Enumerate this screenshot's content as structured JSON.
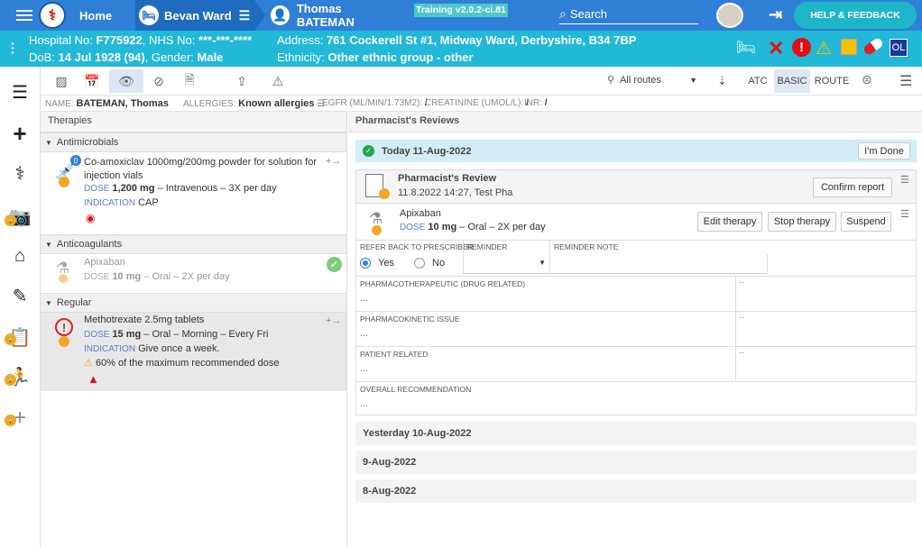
{
  "topbar": {
    "home_label": "Home",
    "ward_label": "Bevan Ward",
    "patient_label": "Thomas BATEMAN",
    "training_badge": "Training v2.0.2-ci.81",
    "search_placeholder": "Search",
    "help_label": "HELP & FEEDBACK"
  },
  "patient": {
    "hospital_no_label": "Hospital No:",
    "hospital_no": "F775922",
    "nhs_label": "NHS No:",
    "nhs_no": "***-***-****",
    "dob_label": "DoB:",
    "dob": "14 Jul 1928 (94)",
    "gender_label": "Gender:",
    "gender": "Male",
    "address_label": "Address:",
    "address": "761 Cockerell St #1, Midway Ward, Derbyshire, B34 7BP",
    "ethnicity_label": "Ethnicity:",
    "ethnicity": "Other ethnic group - other",
    "ol_badge": "OL"
  },
  "toolbar": {
    "routes_label": "All routes",
    "atc_label": "ATC",
    "basic_label": "BASIC",
    "route_label": "ROUTE"
  },
  "infobar": {
    "name_label": "NAME:",
    "name": "BATEMAN, Thomas",
    "allergies_label": "ALLERGIES:",
    "allergies": "Known allergies",
    "egfr_label": "EGFR (ML/MIN/1.73M2):",
    "egfr": "/",
    "creat_label": "CREATININE (UMOL/L):",
    "creat": "/",
    "inr_label": "INR:",
    "inr": "/"
  },
  "therapies": {
    "title": "Therapies",
    "groups": [
      {
        "name": "Antimicrobials",
        "drug": "Co-amoxiclav 1000mg/200mg powder for solution for injection vials",
        "badge": "0",
        "dose_label": "DOSE",
        "dose": "1,200 mg",
        "dose_rest": "– Intravenous – 3X per day",
        "indication_label": "INDICATION",
        "indication": "CAP"
      },
      {
        "name": "Anticoagulants",
        "drug": "Apixaban",
        "dose_label": "DOSE",
        "dose": "10 mg",
        "dose_rest": "– Oral – 2X per day"
      },
      {
        "name": "Regular",
        "drug": "Methotrexate 2.5mg tablets",
        "dose_label": "DOSE",
        "dose": "15 mg",
        "dose_rest": "– Oral – Morning – Every Fri",
        "indication_label": "INDICATION",
        "indication": "Give once a week.",
        "warning": "60% of the maximum recommended dose"
      }
    ]
  },
  "reviews": {
    "title": "Pharmacist's Reviews",
    "today": "Today 11-Aug-2022",
    "done_label": "I'm Done",
    "review_title": "Pharmacist's Review",
    "review_sub": "11.8.2022 14:27, Test Pha",
    "confirm_label": "Confirm report",
    "drug": "Apixaban",
    "dose_label": "DOSE",
    "dose": "10 mg",
    "dose_rest": "– Oral – 2X per day",
    "edit_label": "Edit therapy",
    "stop_label": "Stop therapy",
    "suspend_label": "Suspend",
    "refer_label": "REFER BACK TO PRESCRIBER",
    "yes_label": "Yes",
    "no_label": "No",
    "reminder_label": "REMINDER",
    "reminder_note_label": "REMINDER NOTE",
    "pharmaco_label": "PHARMACOTHERAPEUTIC (DRUG RELATED)",
    "kinetic_label": "PHARMACOKINETIC ISSUE",
    "patient_related_label": "PATIENT RELATED",
    "overall_label": "OVERALL RECOMMENDATION",
    "placeholder": "...",
    "dash": "--",
    "days": [
      "Yesterday 10-Aug-2022",
      "9-Aug-2022",
      "8-Aug-2022"
    ]
  },
  "colors": {
    "topbar": "#2f7fd6",
    "patbar": "#22b8d8",
    "accent": "#5b7fc7"
  }
}
